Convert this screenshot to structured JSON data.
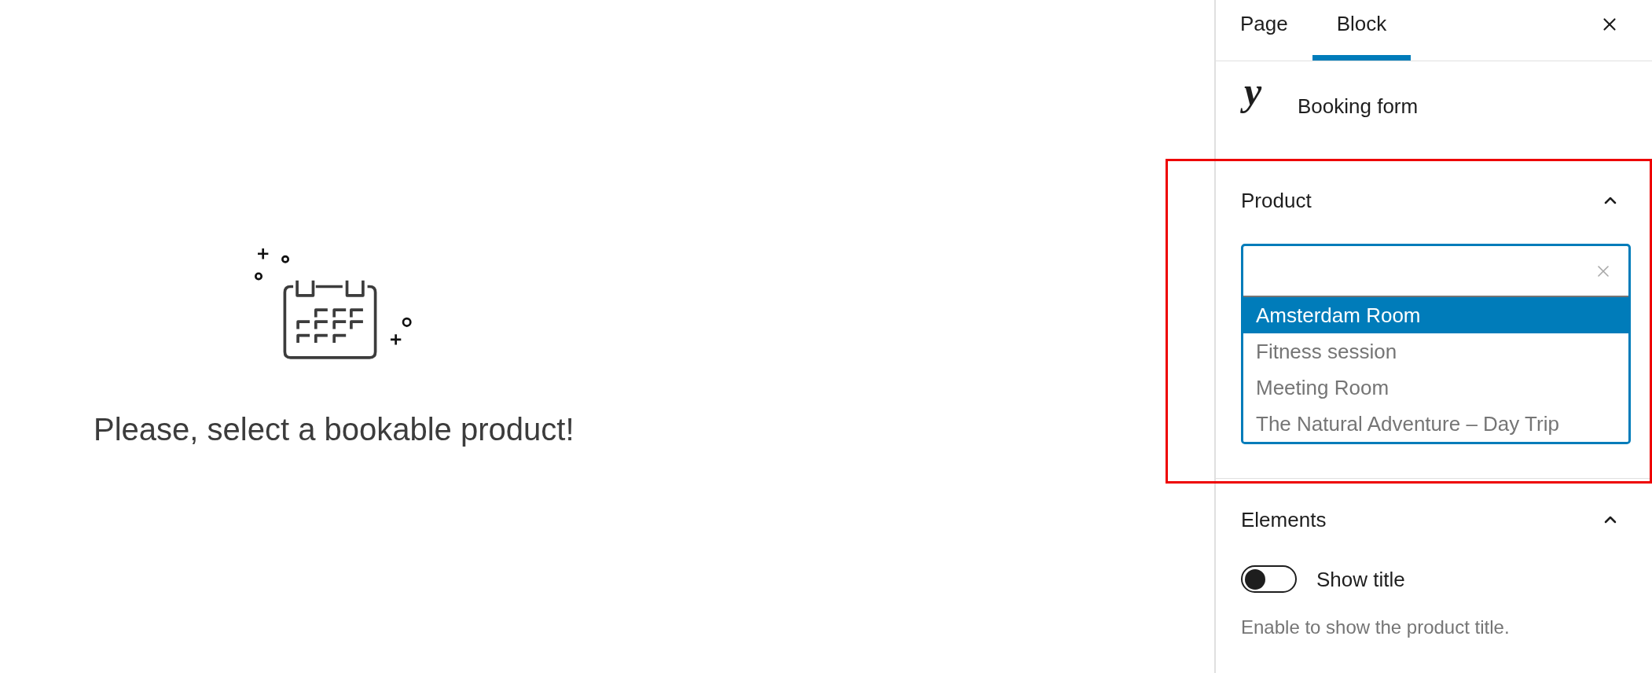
{
  "canvas": {
    "message": "Please, select a bookable product!"
  },
  "sidebar": {
    "tabs": [
      {
        "label": "Page",
        "selected": false
      },
      {
        "label": "Block",
        "selected": true
      }
    ],
    "block": {
      "logo": "y",
      "title": "Booking form"
    },
    "panels": [
      {
        "kind": "select",
        "title": "Product",
        "expanded": true,
        "highlight": true,
        "options": [
          {
            "label": "Amsterdam Room",
            "selected": true
          },
          {
            "label": "Fitness session",
            "selected": false
          },
          {
            "label": "Meeting Room",
            "selected": false
          },
          {
            "label": "The Natural Adventure – Day Trip",
            "selected": false
          }
        ]
      },
      {
        "kind": "toggles",
        "title": "Elements",
        "expanded": true,
        "toggles": [
          {
            "label": "Show title",
            "on": false,
            "help": "Enable to show the product title."
          }
        ]
      }
    ]
  }
}
